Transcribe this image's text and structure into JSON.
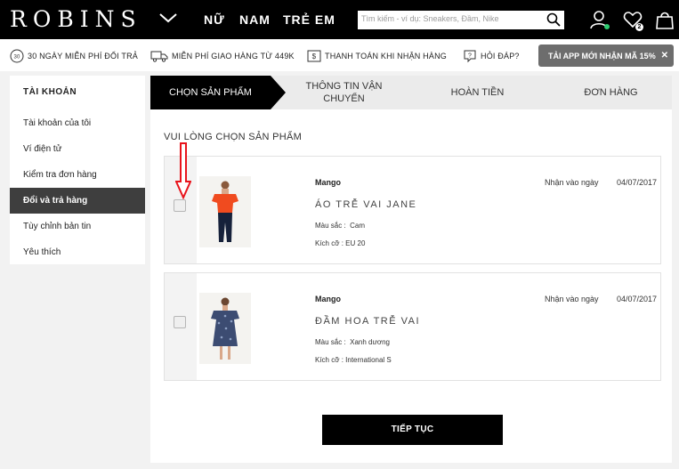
{
  "header": {
    "logo": "ROBINS",
    "nav": [
      "NỮ",
      "NAM",
      "TRẺ EM"
    ],
    "search_placeholder": "Tìm kiếm - ví dụ: Sneakers, Đầm, Nike",
    "wishlist_count": "2",
    "icons": [
      "search-icon",
      "user-icon",
      "heart-icon",
      "bag-icon",
      "chevron-down-icon"
    ]
  },
  "benefits": [
    {
      "icon": "30-days-icon",
      "label": "30 NGÀY MIỄN PHÍ ĐỔI TRẢ"
    },
    {
      "icon": "truck-icon",
      "label": "MIỄN PHÍ GIAO HÀNG TỪ 449K"
    },
    {
      "icon": "cash-icon",
      "label": "THANH TOÁN KHI NHẬN HÀNG"
    },
    {
      "icon": "question-icon",
      "label": "HỎI ĐÁP?"
    }
  ],
  "app_promo": {
    "label": "TẢI APP MỚI NHẬN MÃ 15%",
    "close": "✕"
  },
  "sidebar": {
    "title": "TÀI KHOẢN",
    "items": [
      {
        "label": "Tài khoản của tôi"
      },
      {
        "label": "Ví điện tử"
      },
      {
        "label": "Kiểm tra đơn hàng"
      },
      {
        "label": "Đổi và trả hàng",
        "active": true
      },
      {
        "label": "Tùy chỉnh bản tin"
      },
      {
        "label": "Yêu thích"
      }
    ]
  },
  "steps": [
    {
      "label": "CHỌN SẢN PHẨM",
      "active": true
    },
    {
      "label": "THÔNG TIN VẬN CHUYỂN"
    },
    {
      "label": "HOÀN TIỀN"
    },
    {
      "label": "ĐƠN HÀNG"
    }
  ],
  "main": {
    "title": "VUI LÒNG CHỌN SẢN PHẨM",
    "items": [
      {
        "brand": "Mango",
        "received_label": "Nhận vào ngày",
        "received_date": "04/07/2017",
        "name": "ÁO TRỄ VAI JANE",
        "color_label": "Màu sắc :",
        "color": "Cam",
        "size_label": "Kích cỡ :",
        "size": "EU 20"
      },
      {
        "brand": "Mango",
        "received_label": "Nhận vào ngày",
        "received_date": "04/07/2017",
        "name": "ĐẦM HOA TRỄ VAI",
        "color_label": "Màu sắc :",
        "color": "Xanh dương",
        "size_label": "Kích cỡ :",
        "size": "International S"
      }
    ],
    "continue_label": "TIẾP TỤC"
  },
  "colors": {
    "accent": "#000000",
    "sidebar_active": "#3e3e3e",
    "annotation_arrow": "#e8141c",
    "wishlist_dot": "#2ecc71"
  }
}
